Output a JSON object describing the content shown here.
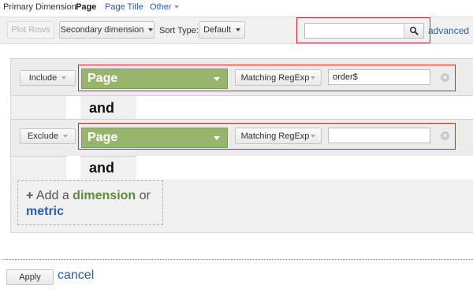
{
  "primary_dimension": {
    "label": "Primary Dimension:",
    "active": "Page",
    "links": [
      "Page Title",
      "Other"
    ]
  },
  "toolbar": {
    "plot_rows": "Plot Rows",
    "secondary_dimension": "Secondary dimension",
    "sort_type_label": "Sort Type:",
    "sort_type_value": "Default",
    "search_value": "",
    "advanced": "advanced"
  },
  "filters": [
    {
      "mode": "Include",
      "dimension": "Page",
      "match_type": "Matching RegExp",
      "value": "order$"
    },
    {
      "mode": "Exclude",
      "dimension": "Page",
      "match_type": "Matching RegExp",
      "value": ""
    }
  ],
  "connector": "and",
  "add_condition": {
    "plus": "+",
    "add_a": "Add a",
    "dimension": "dimension",
    "or": "or",
    "metric": "metric"
  },
  "actions": {
    "apply": "Apply",
    "cancel": "cancel"
  },
  "colors": {
    "dimension_green": "#98b56d",
    "link_blue": "#2a5db0",
    "highlight_red": "#e0222a"
  },
  "icons": {
    "search": "search-icon",
    "clear": "clear-icon"
  }
}
